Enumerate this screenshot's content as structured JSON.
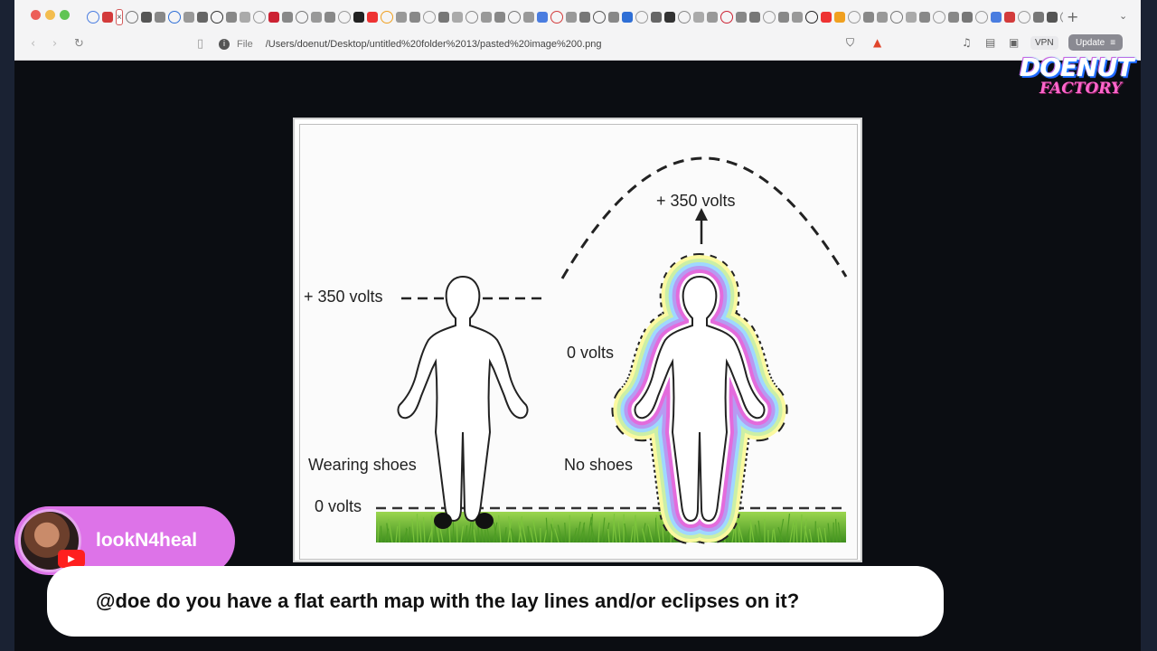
{
  "browser": {
    "address": {
      "scheme_label": "File",
      "url": "/Users/doenut/Desktop/untitled%20folder%2013/pasted%20image%200.png"
    },
    "vpn_label": "VPN",
    "update_label": "Update",
    "new_tab_glyph": "+",
    "tab_menu_glyph": "⌄",
    "active_tab_glyph": "×"
  },
  "overlay": {
    "logo_line1": "DOENUT",
    "logo_line2": "FACTORY"
  },
  "diagram": {
    "left_label_top": "+ 350 volts",
    "left_label_shoes": "Wearing shoes",
    "left_label_bottom": "0 volts",
    "right_label_top": "+ 350 volts",
    "right_label_mid": "0 volts",
    "right_label_shoes": "No shoes"
  },
  "chat": {
    "username": "lookN4heal",
    "message": "@doe do you have a flat earth map with the lay lines and/or eclipses on it?"
  },
  "colors": {
    "chat_pill": "#dd73e8",
    "grass": "#5fae2e",
    "aura_pink": "#e36bdc",
    "aura_blue": "#7fc6ff",
    "aura_yellow": "#f3f07a"
  },
  "icons": {
    "back": "chevron-left-icon",
    "forward": "chevron-right-icon",
    "reload": "reload-icon",
    "bookmark": "bookmark-icon",
    "shield": "brave-shield-icon",
    "rewards": "rewards-triangle-icon",
    "music": "music-note-icon",
    "sidebar": "sidebar-icon",
    "wallet": "wallet-icon",
    "youtube": "youtube-icon"
  }
}
